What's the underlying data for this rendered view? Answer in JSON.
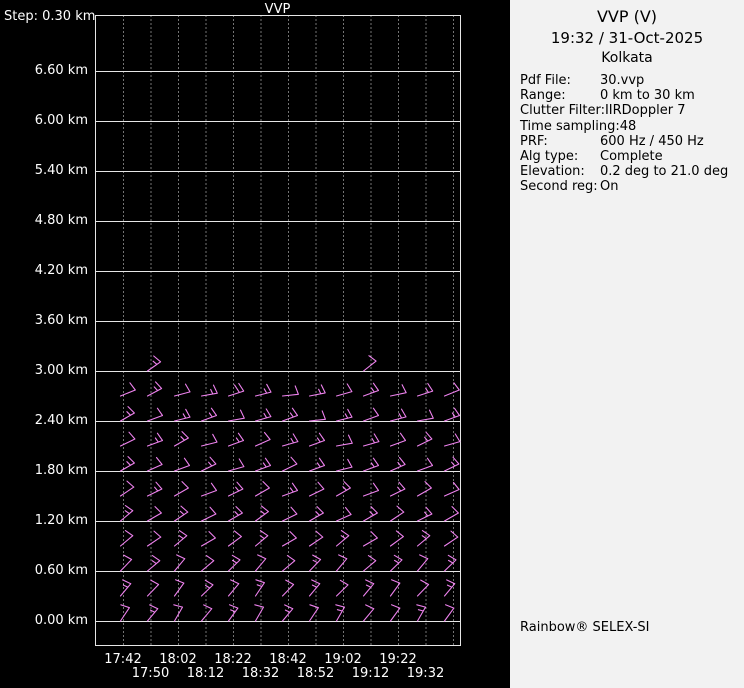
{
  "chart_data": {
    "type": "wind-barb-time-height-profile",
    "title": "VVP",
    "step_label": "Step: 0.30 km",
    "grid_color": "#e6e6e6",
    "barb_color": "#ee82ee",
    "y_axis_km": {
      "min": 0.0,
      "max": 6.6,
      "label_step_km": 0.6,
      "profile_step_km": 0.3
    },
    "y_tick_labels": [
      "6.60 km",
      "6.00 km",
      "5.40 km",
      "4.80 km",
      "4.20 km",
      "3.60 km",
      "3.00 km",
      "2.40 km",
      "1.80 km",
      "1.20 km",
      "0.60 km",
      "0.00 km"
    ],
    "x_tick_labels": [
      "17:42",
      "17:50",
      "18:02",
      "18:12",
      "18:22",
      "18:32",
      "18:42",
      "18:52",
      "19:02",
      "19:12",
      "19:22",
      "19:32"
    ],
    "rows": [
      {
        "alt_km": 3.0,
        "dirs_deg": [
          null,
          55,
          null,
          null,
          null,
          null,
          null,
          null,
          null,
          52,
          null,
          null,
          null
        ],
        "speeds_kt": [
          null,
          15,
          null,
          null,
          null,
          null,
          null,
          null,
          null,
          10,
          null,
          null,
          null
        ]
      },
      {
        "alt_km": 2.7,
        "dirs_deg": [
          68,
          62,
          75,
          80,
          72,
          76,
          84,
          79,
          74,
          70,
          78,
          72,
          68
        ],
        "speeds_kt": [
          10,
          15,
          10,
          15,
          20,
          15,
          10,
          15,
          10,
          15,
          10,
          15,
          10
        ]
      },
      {
        "alt_km": 2.4,
        "dirs_deg": [
          60,
          70,
          76,
          70,
          80,
          74,
          70,
          84,
          76,
          70,
          75,
          80,
          70
        ],
        "speeds_kt": [
          15,
          10,
          15,
          15,
          10,
          15,
          15,
          10,
          15,
          10,
          15,
          10,
          15
        ]
      },
      {
        "alt_km": 2.1,
        "dirs_deg": [
          64,
          70,
          60,
          76,
          70,
          66,
          74,
          70,
          80,
          74,
          70,
          64,
          74
        ],
        "speeds_kt": [
          10,
          15,
          15,
          10,
          15,
          10,
          15,
          15,
          10,
          15,
          10,
          15,
          10
        ]
      },
      {
        "alt_km": 1.8,
        "dirs_deg": [
          60,
          66,
          70,
          64,
          74,
          70,
          64,
          70,
          76,
          70,
          66,
          70,
          64
        ],
        "speeds_kt": [
          15,
          10,
          10,
          15,
          10,
          15,
          10,
          15,
          10,
          15,
          15,
          10,
          15
        ]
      },
      {
        "alt_km": 1.5,
        "dirs_deg": [
          56,
          64,
          60,
          70,
          64,
          60,
          70,
          64,
          60,
          70,
          64,
          60,
          66
        ],
        "speeds_kt": [
          10,
          15,
          10,
          10,
          15,
          10,
          15,
          10,
          15,
          10,
          15,
          10,
          10
        ]
      },
      {
        "alt_km": 1.2,
        "dirs_deg": [
          50,
          60,
          56,
          64,
          60,
          54,
          64,
          60,
          66,
          60,
          56,
          64,
          60
        ],
        "speeds_kt": [
          15,
          10,
          15,
          10,
          15,
          15,
          10,
          15,
          10,
          15,
          10,
          15,
          10
        ]
      },
      {
        "alt_km": 0.9,
        "dirs_deg": [
          50,
          56,
          50,
          60,
          54,
          50,
          60,
          56,
          50,
          60,
          54,
          50,
          56
        ],
        "speeds_kt": [
          10,
          10,
          15,
          10,
          10,
          15,
          10,
          10,
          15,
          10,
          10,
          15,
          10
        ]
      },
      {
        "alt_km": 0.6,
        "dirs_deg": [
          44,
          50,
          40,
          50,
          46,
          40,
          50,
          44,
          40,
          50,
          46,
          40,
          46
        ],
        "speeds_kt": [
          10,
          15,
          10,
          10,
          15,
          10,
          10,
          15,
          10,
          10,
          15,
          10,
          15
        ]
      },
      {
        "alt_km": 0.3,
        "dirs_deg": [
          40,
          44,
          36,
          46,
          40,
          34,
          44,
          40,
          46,
          40,
          36,
          44,
          40
        ],
        "speeds_kt": [
          15,
          10,
          10,
          15,
          10,
          15,
          10,
          15,
          10,
          15,
          10,
          10,
          15
        ]
      },
      {
        "alt_km": 0.0,
        "dirs_deg": [
          34,
          40,
          30,
          40,
          36,
          30,
          40,
          34,
          30,
          40,
          36,
          30,
          36
        ],
        "speeds_kt": [
          10,
          15,
          10,
          10,
          15,
          10,
          15,
          10,
          15,
          10,
          10,
          15,
          10
        ]
      }
    ]
  },
  "panel": {
    "title": "VVP (V)",
    "datetime": "19:32 / 31-Oct-2025",
    "location": "Kolkata",
    "fields": [
      {
        "label": "Pdf File:",
        "value": "30.vvp"
      },
      {
        "label": "Range:",
        "value": "0 km to 30 km"
      },
      {
        "label": "Clutter Filter:",
        "value": "IIRDoppler 7"
      },
      {
        "label": "Time sampling:",
        "value": "48"
      },
      {
        "label": "PRF:",
        "value": "600 Hz / 450 Hz"
      },
      {
        "label": "Alg type:",
        "value": "Complete"
      },
      {
        "label": "Elevation:",
        "value": "0.2 deg to 21.0 deg"
      },
      {
        "label": "Second reg:",
        "value": "On"
      }
    ],
    "footer": "Rainbow® SELEX-SI"
  }
}
